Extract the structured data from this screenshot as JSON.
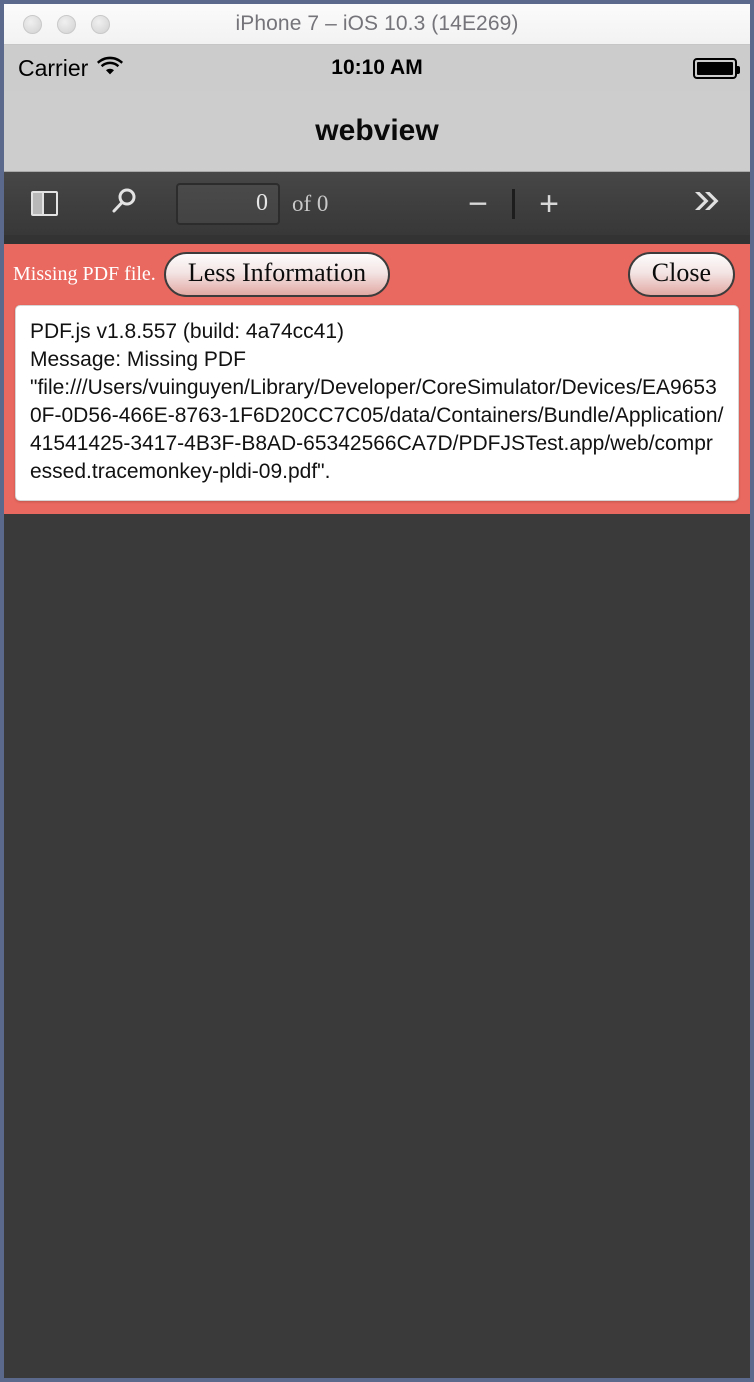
{
  "window": {
    "title": "iPhone 7 – iOS 10.3 (14E269)",
    "traffic_lights": [
      "close",
      "minimize",
      "zoom"
    ]
  },
  "status_bar": {
    "carrier": "Carrier",
    "wifi_icon": "wifi-icon",
    "time": "10:10 AM",
    "battery_icon": "battery-full-icon"
  },
  "nav_bar": {
    "title": "webview"
  },
  "pdf_toolbar": {
    "sidebar_toggle_icon": "sidebar-toggle-icon",
    "search_icon": "search-icon",
    "page_number_value": "0",
    "page_number_placeholder": "0",
    "page_count_label": "of 0",
    "zoom_out_label": "−",
    "zoom_in_label": "+",
    "more_tools_icon": "chevron-double-right-icon"
  },
  "error": {
    "message": "Missing PDF file.",
    "info_button_label": "Less Information",
    "close_button_label": "Close",
    "details": [
      "PDF.js v1.8.557 (build: 4a74cc41)",
      "Message: Missing PDF",
      "\"file:///Users/vuinguyen/Library/Developer/CoreSimulator/Devices/EA96530F-0D56-466E-8763-1F6D20CC7C05/data/Containers/Bundle/Application/41541425-3417-4B3F-B8AD-65342566CA7D/PDFJSTest.app/web/compressed.tracemonkey-pldi-09.pdf\"."
    ]
  },
  "colors": {
    "error_background": "#e9685f",
    "toolbar_background": "#3f3f3f",
    "viewer_background": "#3a3a3a",
    "nav_background": "#cdcdcd",
    "window_border": "#5b6a8c"
  }
}
